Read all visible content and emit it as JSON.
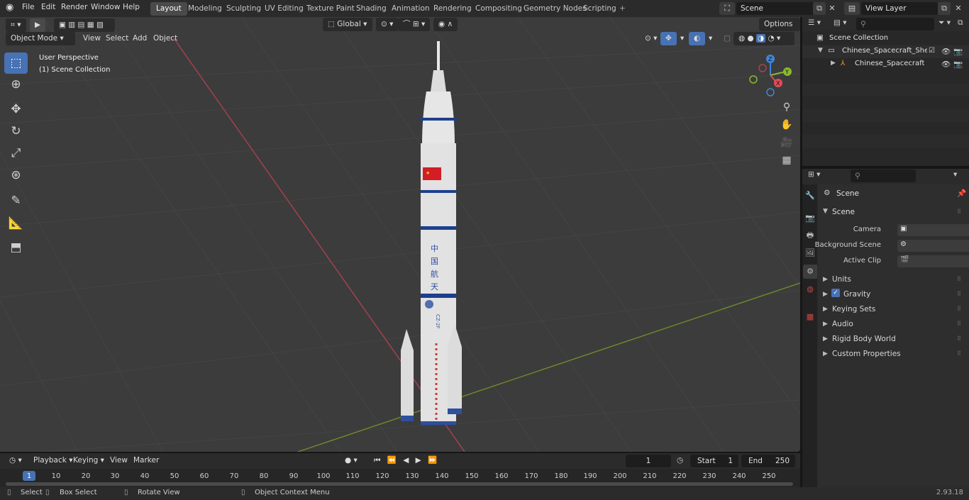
{
  "topbar": {
    "menus": [
      "File",
      "Edit",
      "Render",
      "Window",
      "Help"
    ],
    "workspaces": [
      {
        "label": "Layout",
        "active": true
      },
      {
        "label": "Modeling"
      },
      {
        "label": "Sculpting"
      },
      {
        "label": "UV Editing"
      },
      {
        "label": "Texture Paint"
      },
      {
        "label": "Shading"
      },
      {
        "label": "Animation"
      },
      {
        "label": "Rendering"
      },
      {
        "label": "Compositing"
      },
      {
        "label": "Geometry Nodes"
      },
      {
        "label": "Scripting"
      }
    ],
    "add_workspace": "+",
    "scene_name": "Scene",
    "view_layer_name": "View Layer"
  },
  "viewport_header": {
    "mode": "Object Mode",
    "menus": [
      "View",
      "Select",
      "Add",
      "Object"
    ],
    "transform_orientation": "Global",
    "options_label": "Options"
  },
  "viewport": {
    "overlay_line1": "User Perspective",
    "overlay_line2": "(1) Scene Collection",
    "gizmo": {
      "x": "X",
      "y": "Y",
      "z": "Z"
    },
    "rocket_text": [
      "中",
      "国",
      "航",
      "天"
    ],
    "rocket_code": "CZ-2F"
  },
  "outliner": {
    "root": "Scene Collection",
    "collection": "Chinese_Spacecraft_Shenzhou",
    "object": "Chinese_Spacecraft_Shenzhou"
  },
  "properties": {
    "header": "Scene",
    "panel": "Scene",
    "fields": [
      {
        "label": "Camera"
      },
      {
        "label": "Background Scene"
      },
      {
        "label": "Active Clip"
      }
    ],
    "sections": [
      "Units",
      "Gravity",
      "Keying Sets",
      "Audio",
      "Rigid Body World",
      "Custom Properties"
    ],
    "gravity_checked": true
  },
  "timeline": {
    "menus": [
      "Playback",
      "Keying",
      "View",
      "Marker"
    ],
    "current_frame": "1",
    "start_label": "Start",
    "start": "1",
    "end_label": "End",
    "end": "250",
    "ruler": [
      "1",
      "10",
      "20",
      "30",
      "40",
      "50",
      "60",
      "70",
      "80",
      "90",
      "100",
      "110",
      "120",
      "130",
      "140",
      "150",
      "160",
      "170",
      "180",
      "190",
      "200",
      "210",
      "220",
      "230",
      "240",
      "250"
    ]
  },
  "statusbar": {
    "items": [
      "Select",
      "Box Select",
      "Rotate View",
      "Object Context Menu"
    ],
    "version": "2.93.18"
  },
  "colors": {
    "accent": "#4772b3",
    "x_axis": "#a8424f",
    "y_axis": "#6e8c2a",
    "gizmo_x": "#e24b5a",
    "gizmo_y": "#8ab82d",
    "gizmo_z": "#3f86d8"
  }
}
